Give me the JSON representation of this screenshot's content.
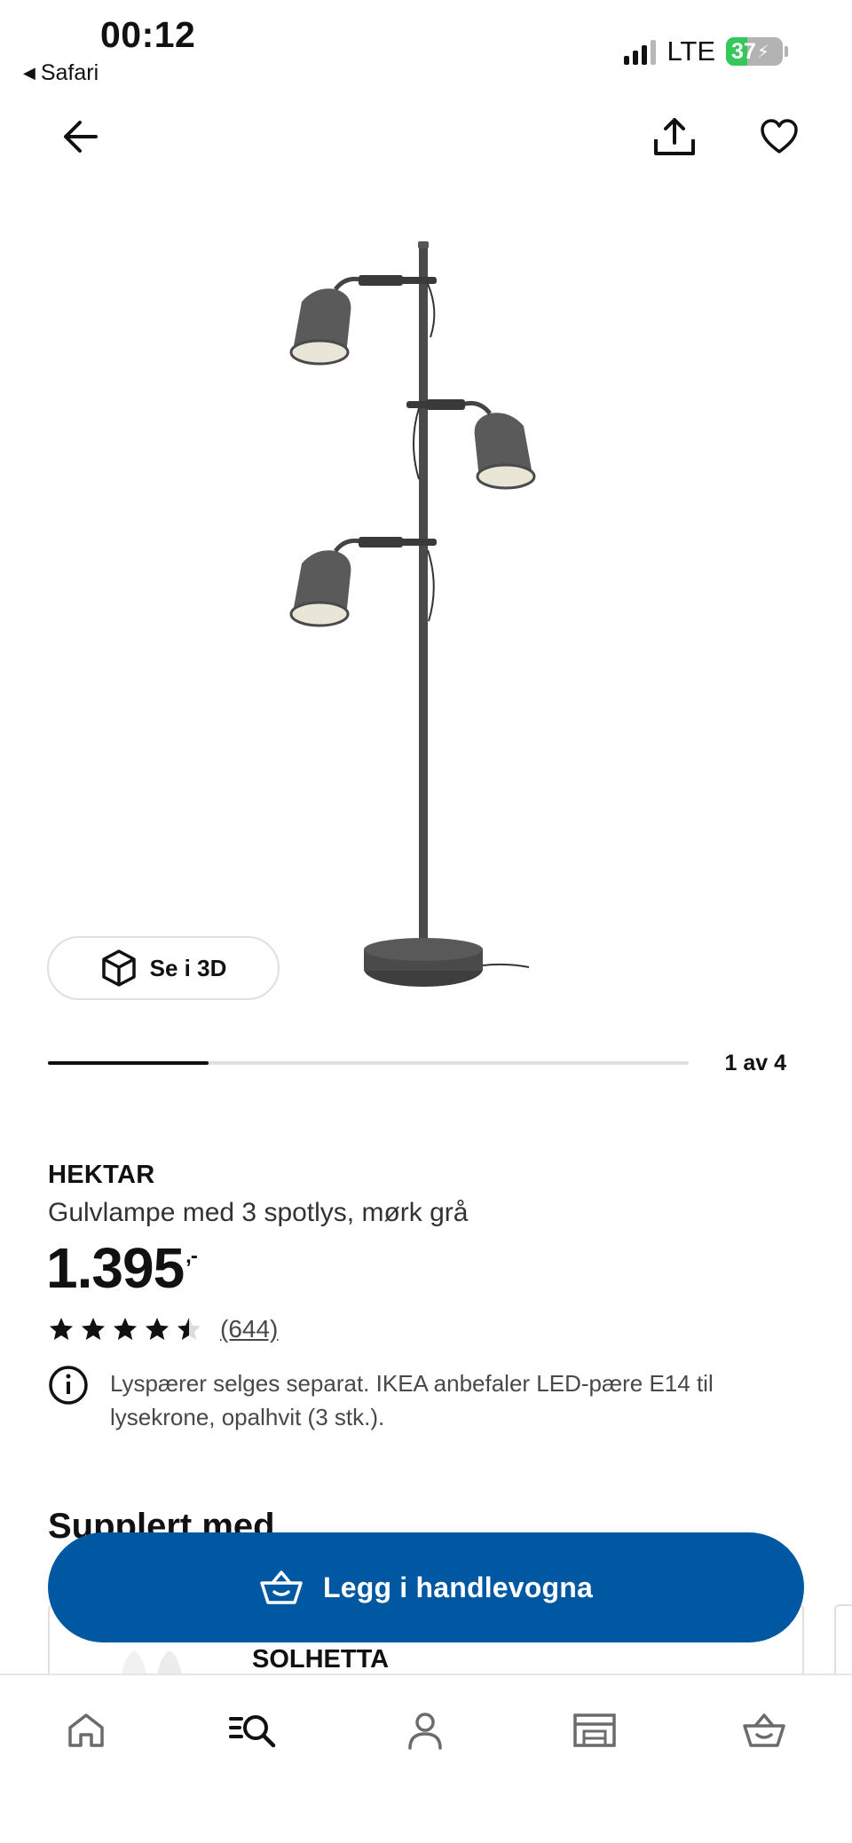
{
  "status_bar": {
    "time": "00:12",
    "back_app": "Safari",
    "network": "LTE",
    "battery": "37"
  },
  "top_bar": {
    "back_icon": "arrow-left-icon",
    "share_icon": "share-icon",
    "favorite_icon": "heart-icon"
  },
  "gallery": {
    "view_3d_label": "Se i 3D",
    "view_3d_icon": "cube-icon",
    "position_text": "1 av 4",
    "current": 1,
    "total": 4
  },
  "product": {
    "brand": "HEKTAR",
    "description": "Gulvlampe med 3 spotlys, mørk grå",
    "price": "1.395",
    "price_suffix": ",-",
    "rating": 4.5,
    "rating_max": 5,
    "review_count": "(644)",
    "info_icon": "info-icon",
    "info_text": "Lyspærer selges separat. IKEA anbefaler LED-pære E14 til lysekrone, opalhvit (3 stk.)."
  },
  "complement": {
    "title": "Supplert med",
    "card_name": "SOLHETTA"
  },
  "cart_button": {
    "label": "Legg i handlevogna",
    "icon": "basket-icon"
  },
  "bottom_nav": {
    "items": [
      "home-icon",
      "search-list-icon",
      "profile-icon",
      "store-icon",
      "cart-icon"
    ]
  },
  "colors": {
    "primary_blue": "#0058a3",
    "battery_green": "#34c759",
    "text": "#111111",
    "muted_text": "#484848",
    "border": "#dfdfdf"
  }
}
